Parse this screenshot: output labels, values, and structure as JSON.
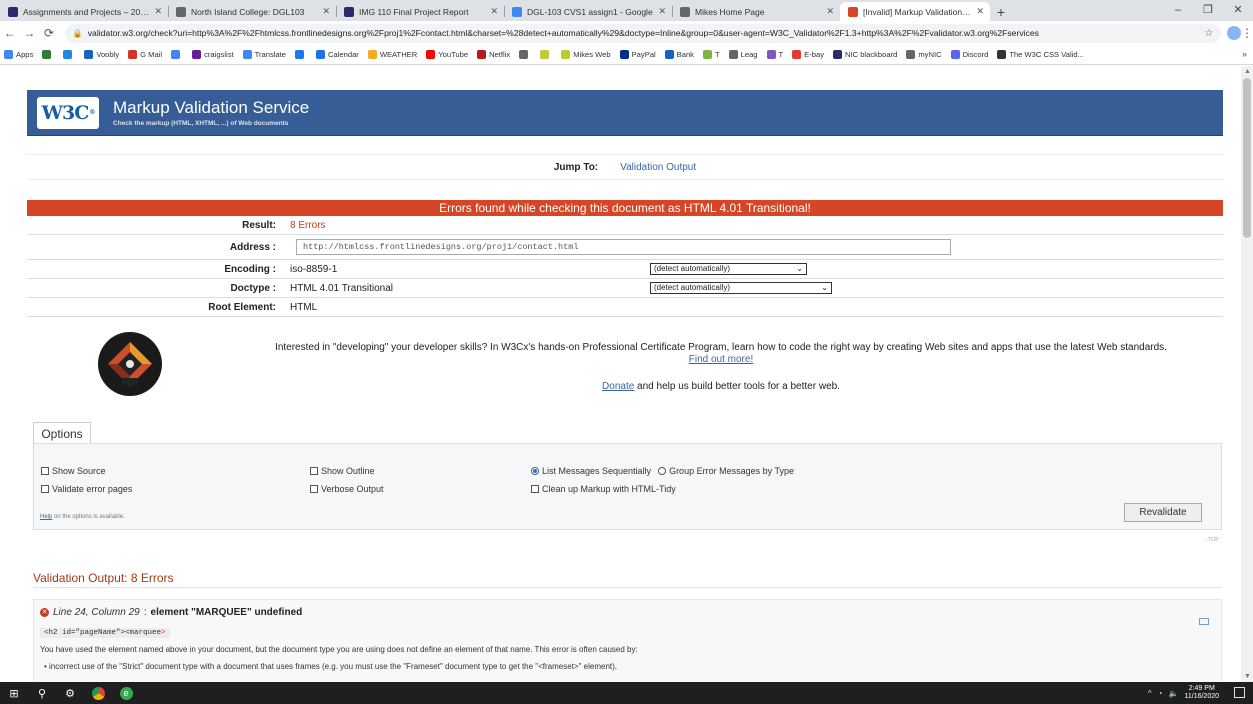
{
  "browser": {
    "tabs": [
      {
        "title": "Assignments and Projects – 2020",
        "fav": "#2b2b6b",
        "active": false
      },
      {
        "title": "North Island College: DGL103",
        "fav": "#666666",
        "active": false
      },
      {
        "title": "IMG 110 Final Project Report",
        "fav": "#2b2b6b",
        "active": false
      },
      {
        "title": "DGL-103 CVS1 assign1 - Google",
        "fav": "#4285f4",
        "active": false
      },
      {
        "title": "Mikes Home Page",
        "fav": "#666666",
        "active": false
      },
      {
        "title": "[Invalid] Markup Validation of htr",
        "fav": "#d64525",
        "active": true
      }
    ],
    "url": "validator.w3.org/check?uri=http%3A%2F%2Fhtmlcss.frontlinedesigns.org%2Fproj1%2Fcontact.html&charset=%28detect+automatically%29&doctype=Inline&group=0&user-agent=W3C_Validator%2F1.3+http%3A%2F%2Fvalidator.w3.org%2Fservices",
    "bookmarks": [
      {
        "label": "Apps",
        "color": "#4285f4"
      },
      {
        "label": "",
        "color": "#2e7d32"
      },
      {
        "label": "",
        "color": "#1e88e5"
      },
      {
        "label": "Voobly",
        "color": "#1565c0"
      },
      {
        "label": "G Mail",
        "color": "#d93025"
      },
      {
        "label": "",
        "color": "#4285f4"
      },
      {
        "label": "craigslist",
        "color": "#6a1b9a"
      },
      {
        "label": "Translate",
        "color": "#4285f4"
      },
      {
        "label": "",
        "color": "#1877f2"
      },
      {
        "label": "Calendar",
        "color": "#1a73e8"
      },
      {
        "label": "WEATHER",
        "color": "#f9a825"
      },
      {
        "label": "YouTube",
        "color": "#ff0000"
      },
      {
        "label": "Netflix",
        "color": "#b71c1c"
      },
      {
        "label": "",
        "color": "#666666"
      },
      {
        "label": "",
        "color": "#c0ca33"
      },
      {
        "label": "Mikes Web",
        "color": "#c0ca33"
      },
      {
        "label": "PayPal",
        "color": "#003087"
      },
      {
        "label": "Bank",
        "color": "#1565c0"
      },
      {
        "label": "T",
        "color": "#7cb342"
      },
      {
        "label": "Leag",
        "color": "#666666"
      },
      {
        "label": "T",
        "color": "#7e57c2"
      },
      {
        "label": "E-bay",
        "color": "#e53935"
      },
      {
        "label": "NIC blackboard",
        "color": "#2b2b6b"
      },
      {
        "label": "myNIC",
        "color": "#666666"
      },
      {
        "label": "Discord",
        "color": "#5865f2"
      },
      {
        "label": "The W3C CSS Valid...",
        "color": "#333333"
      }
    ]
  },
  "banner": {
    "logo": "W3C",
    "title": "Markup Validation Service",
    "subtitle": "Check the markup (HTML, XHTML, ...) of Web documents"
  },
  "jump": {
    "label": "Jump To:",
    "link": "Validation Output"
  },
  "result_header": "Errors found while checking this document as HTML 4.01 Transitional!",
  "results": {
    "result_label": "Result:",
    "result_value": "8 Errors",
    "address_label": "Address :",
    "address_value": "http://htmlcss.frontlinedesigns.org/proj1/contact.html",
    "encoding_label": "Encoding :",
    "encoding_value": "iso-8859-1",
    "encoding_select": "(detect automatically)",
    "doctype_label": "Doctype :",
    "doctype_value": "HTML 4.01 Transitional",
    "doctype_select": "(detect automatically)",
    "root_label": "Root Element:",
    "root_value": "HTML"
  },
  "promo": {
    "text": "Interested in \"developing\" your developer skills? In W3Cx's hands-on Professional Certificate Program, learn how to code the right way by creating Web sites and apps that use the latest Web standards.",
    "link": "Find out more!",
    "donate_link": "Donate",
    "donate_text": " and help us build better tools for a better web."
  },
  "options": {
    "tab": "Options",
    "show_source": "Show Source",
    "show_outline": "Show Outline",
    "list_seq": "List Messages Sequentially",
    "group_type": "Group Error Messages by Type",
    "validate_error": "Validate error pages",
    "verbose": "Verbose Output",
    "cleanup": "Clean up Markup with HTML-Tidy",
    "help_link": "Help",
    "help_text": " on the options is available.",
    "revalidate": "Revalidate",
    "top": "↑TOP"
  },
  "validation": {
    "title": "Validation Output: 8 Errors",
    "msg_loc": "Line 24, Column 29",
    "msg_title": "element \"MARQUEE\" undefined",
    "code_pre": "<h2 id=\"pageName\"><marquee",
    "code_hl": ">",
    "body": "You have used the element named above in your document, but the document type you are using does not define an element of that name. This error is often caused by:",
    "bullet": "• incorrect use of the \"Strict\" document type with a document that uses frames (e.g. you must use the \"Frameset\" document type to get the \"<frameset>\" element),"
  },
  "taskbar": {
    "time": "2:49 PM",
    "date": "11/16/2020"
  }
}
